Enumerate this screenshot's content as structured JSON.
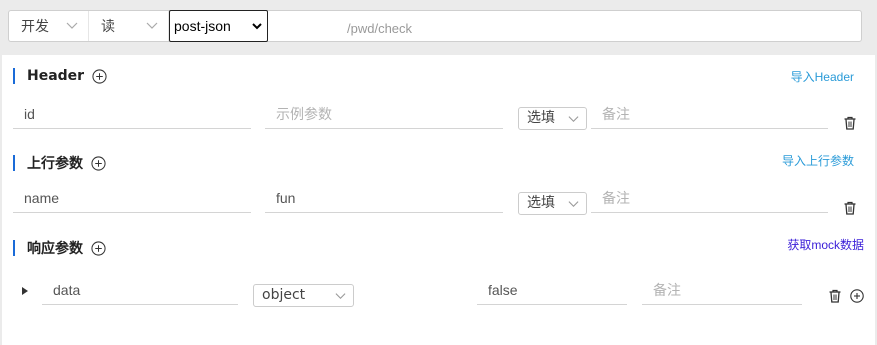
{
  "topbar": {
    "env_label": "开发",
    "rw_label": "读",
    "type_value": "post-json",
    "url": "/pwd/check"
  },
  "header_section": {
    "title": "Header",
    "import_link": "导入Header",
    "row": {
      "name_value": "id",
      "example_placeholder": "示例参数",
      "required_value": "选填",
      "remark_placeholder": "备注"
    }
  },
  "request_section": {
    "title": "上行参数",
    "import_link": "导入上行参数",
    "row": {
      "name_value": "name",
      "example_value": "fun",
      "required_value": "选填",
      "remark_placeholder": "备注"
    }
  },
  "response_section": {
    "title": "响应参数",
    "mock_link": "获取mock数据",
    "row": {
      "name_value": "data",
      "type_value": "object",
      "example_value": "false",
      "remark_placeholder": "备注"
    }
  },
  "colors": {
    "accent_bar": "#1a6bd8",
    "link": "#2a9bd8",
    "mock_link": "#3a1ed8"
  }
}
